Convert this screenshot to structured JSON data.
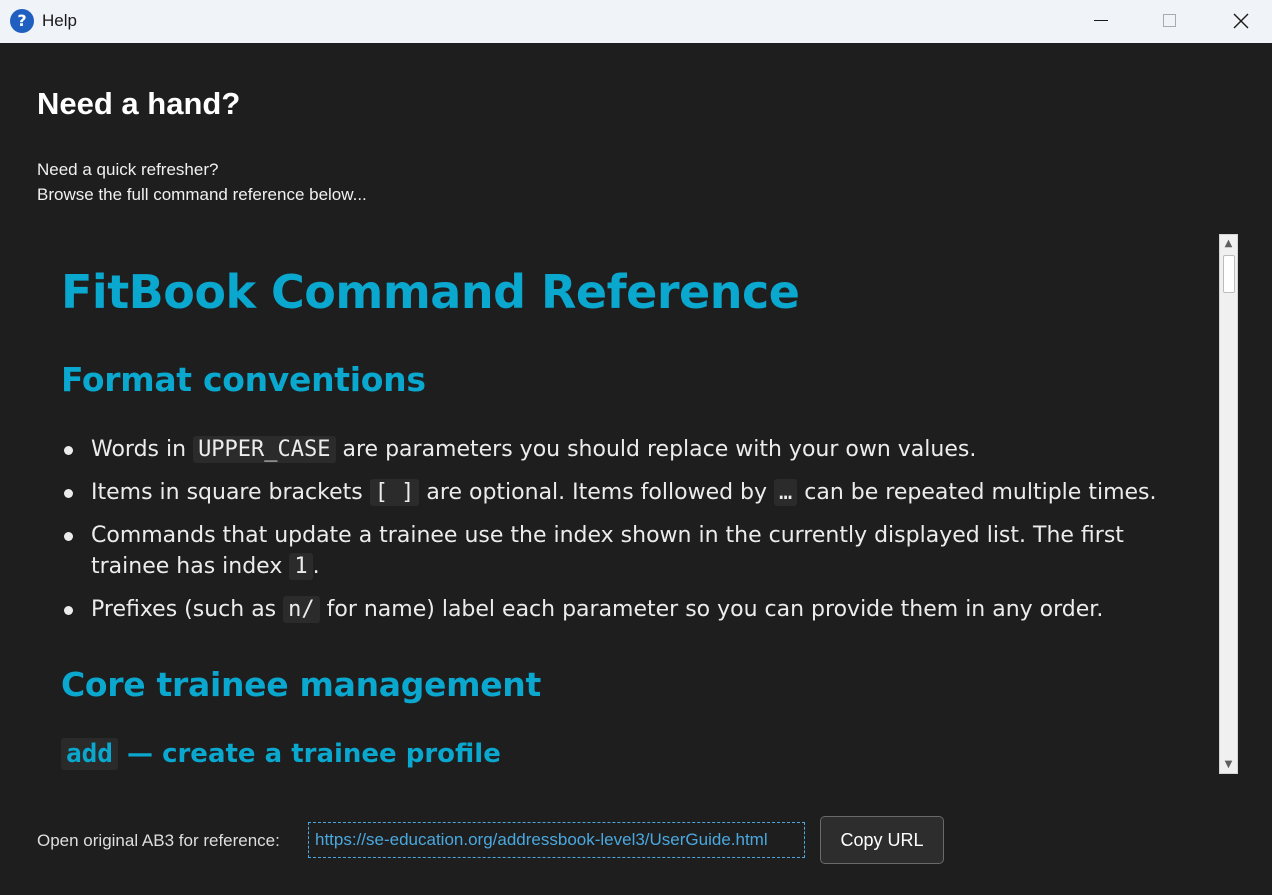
{
  "window": {
    "title": "Help",
    "icon": "help-question-icon",
    "controls": [
      "minimize",
      "maximize",
      "close"
    ]
  },
  "header": {
    "title": "Need a hand?",
    "line1": "Need a quick refresher?",
    "line2": "Browse the full command reference below..."
  },
  "doc": {
    "h1": "FitBook Command Reference",
    "section1": "Format conventions",
    "bullets": {
      "b1": {
        "pre": "Words in ",
        "code": "UPPER_CASE",
        "post": " are parameters you should replace with your own values."
      },
      "b2": {
        "pre": "Items in square brackets ",
        "code1": "[ ]",
        "mid": " are optional. Items followed by ",
        "code2": "…",
        "post": " can be repeated multiple times."
      },
      "b3": {
        "pre": "Commands that update a trainee use the index shown in the currently displayed list. The first trainee has index ",
        "code": "1",
        "post": "."
      },
      "b4": {
        "pre": "Prefixes (such as ",
        "code": "n/",
        "post": " for name) label each parameter so you can provide them in any order."
      }
    },
    "section2": "Core trainee management",
    "h3_code": "add",
    "h3_text": " — create a trainee profile"
  },
  "footer": {
    "label": "Open original AB3 for reference:",
    "url": "https://se-education.org/addressbook-level3/UserGuide.html",
    "copy_button": "Copy URL"
  },
  "colors": {
    "background": "#1e1e1e",
    "accent": "#0aa7cf",
    "link": "#4aa8df"
  }
}
